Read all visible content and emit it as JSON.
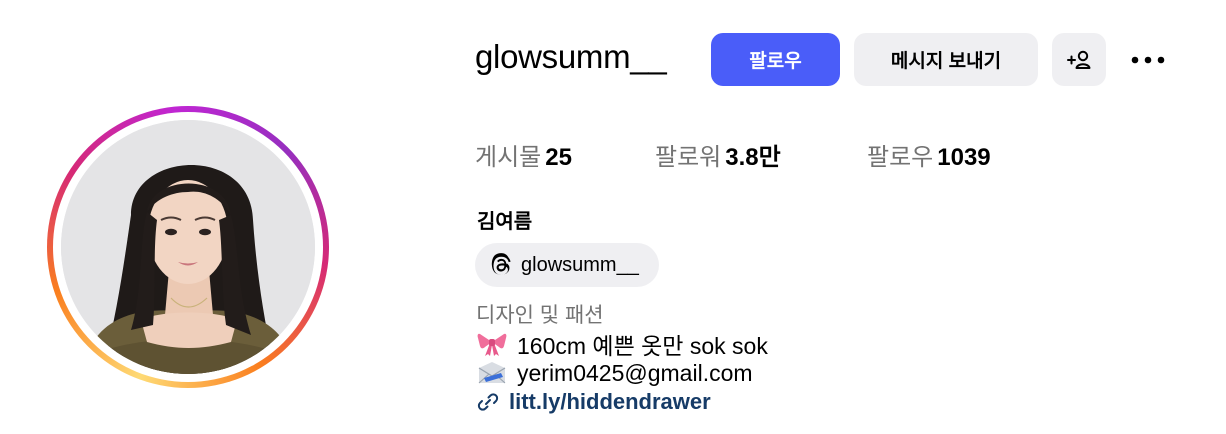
{
  "profile": {
    "username": "glowsumm__",
    "full_name": "김여름",
    "threads_handle": "glowsumm__",
    "category": "디자인 및 패션",
    "bio_lines": [
      {
        "emoji": "ribbon-emoji",
        "text": "160cm 예쁜 옷만 sok sok"
      },
      {
        "emoji": "envelope-emoji",
        "text": "yerim0425@gmail.com"
      }
    ],
    "link": "litt.ly/hiddendrawer"
  },
  "actions": {
    "follow_label": "팔로우",
    "message_label": "메시지 보내기",
    "add_user_icon": "add-user-icon",
    "more_icon": "more-options-icon"
  },
  "stats": {
    "posts_label": "게시물",
    "posts_count": "25",
    "followers_label": "팔로워",
    "followers_count": "3.8만",
    "following_label": "팔로우",
    "following_count": "1039"
  },
  "colors": {
    "follow_button": "#4a5df9",
    "secondary_button": "#efeff2",
    "muted_text": "#737373",
    "link_text": "#163b67"
  }
}
